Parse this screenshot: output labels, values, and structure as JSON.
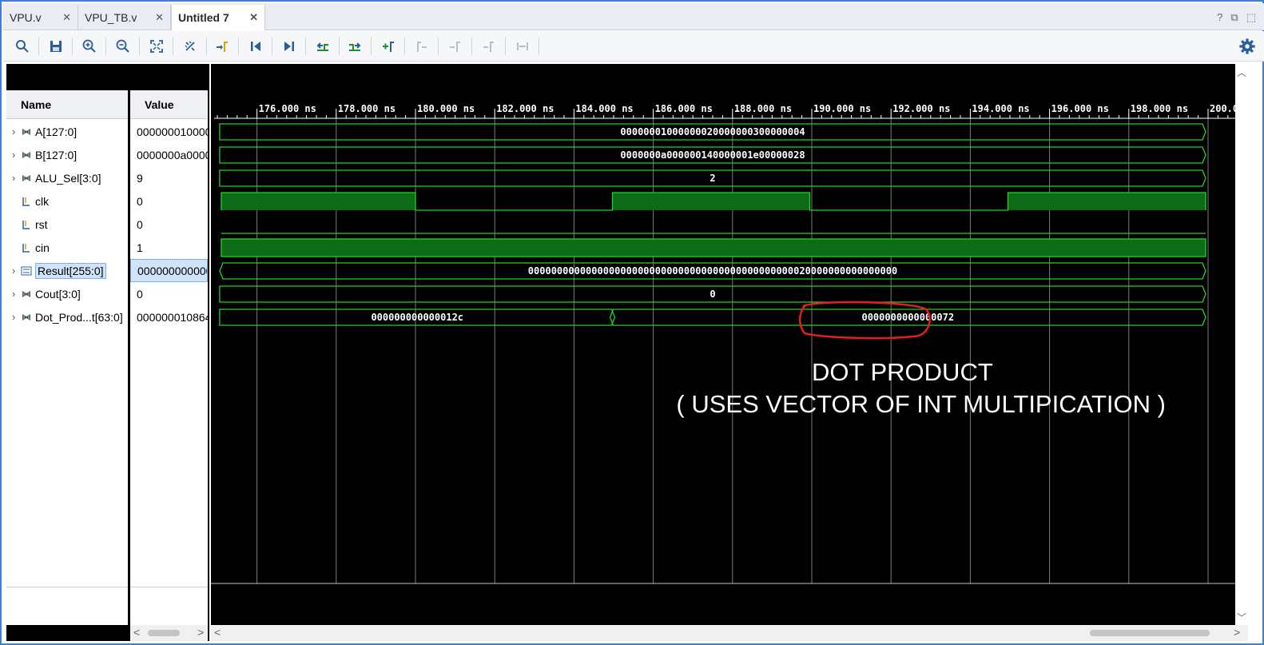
{
  "tabs": [
    {
      "label": "VPU.v",
      "active": false
    },
    {
      "label": "VPU_TB.v",
      "active": false
    },
    {
      "label": "Untitled 7",
      "active": true
    }
  ],
  "window_controls": {
    "help": "?",
    "restore": "⧉",
    "maximize": "⬚"
  },
  "toolbar": {
    "buttons": [
      "search-icon",
      "save-icon",
      "zoom-in-icon",
      "zoom-out-icon",
      "zoom-fit-icon",
      "cursor-icon",
      "go-to-cursor-icon",
      "go-to-start-icon",
      "go-to-end-icon",
      "previous-transition-icon",
      "next-transition-icon",
      "add-marker-icon",
      "previous-marker-icon",
      "next-marker-icon",
      "swap-cursors-icon",
      "snap-icon"
    ],
    "settings": "gear-icon"
  },
  "columns": {
    "name": "Name",
    "value": "Value"
  },
  "signals": [
    {
      "name": "A[127:0]",
      "value": "000000010000",
      "expandable": true,
      "type": "bus"
    },
    {
      "name": "B[127:0]",
      "value": "0000000a0000",
      "expandable": true,
      "type": "bus"
    },
    {
      "name": "ALU_Sel[3:0]",
      "value": "9",
      "expandable": true,
      "type": "bus"
    },
    {
      "name": "clk",
      "value": "0",
      "expandable": false,
      "type": "bit"
    },
    {
      "name": "rst",
      "value": "0",
      "expandable": false,
      "type": "bit"
    },
    {
      "name": "cin",
      "value": "1",
      "expandable": false,
      "type": "bit"
    },
    {
      "name": "Result[255:0]",
      "value": "000000000000",
      "expandable": true,
      "type": "bus",
      "selected": true
    },
    {
      "name": "Cout[3:0]",
      "value": "0",
      "expandable": true,
      "type": "bus"
    },
    {
      "name": "Dot_Prod...t[63:0]",
      "value": "000000010864",
      "expandable": true,
      "type": "bus"
    }
  ],
  "timeline": {
    "unit": "ns",
    "start": 175,
    "end": 200,
    "labels": [
      "176.000 ns",
      "178.000 ns",
      "180.000 ns",
      "182.000 ns",
      "184.000 ns",
      "186.000 ns",
      "188.000 ns",
      "190.000 ns",
      "192.000 ns",
      "194.000 ns",
      "196.000 ns",
      "198.000 ns",
      "200.0"
    ]
  },
  "waveforms": {
    "A": "0000000100000002000000030000000 4",
    "A_text": "00000001000000020000000300000004",
    "B_text": "0000000a000000140000001e00000028",
    "ALU_Sel_text": "2",
    "Result_text": "0000000000000000000000000000000000000000000000020000000000000000",
    "Cout_text": "0",
    "Dot_seg1": "000000000000012c",
    "Dot_seg2": "0000000000000072",
    "clk_high_intervals_ns": [
      [
        175.1,
        180.0
      ],
      [
        184.97,
        189.95
      ],
      [
        194.95,
        199.94
      ]
    ]
  },
  "annotation": {
    "line1": "DOT PRODUCT",
    "line2": "( USES VECTOR OF INT MULTIPICATION )",
    "highlight_color": "#e02020"
  },
  "colors": {
    "wave": "#22d422",
    "wave_fill": "#0b6b16",
    "grid": "#7a7a7a",
    "tab_accent": "#3d7fd6"
  }
}
